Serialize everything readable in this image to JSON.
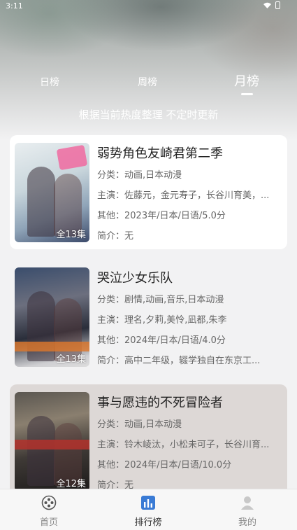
{
  "status_bar": {
    "time": "3:11"
  },
  "tabs": {
    "day": "日榜",
    "week": "周榜",
    "month": "月榜",
    "active": "month"
  },
  "subtitle": "根据当前热度整理 不定时更新",
  "items": [
    {
      "title": "弱势角色友崎君第二季",
      "genre": "分类：动画,日本动漫",
      "cast": "主演：佐藤元，金元寿子，长谷川育美，...",
      "other": "其他：2023年/日本/日语/5.0分",
      "intro": "简介：无",
      "episodes": "全13集"
    },
    {
      "title": "哭泣少女乐队",
      "genre": "分类：剧情,动画,音乐,日本动漫",
      "cast": "主演：理名,夕莉,美怜,凪都,朱李",
      "other": "其他：2024年/日本/日语/4.0分",
      "intro": "简介：高中二年级，辍学独自在东京工...",
      "episodes": "全13集"
    },
    {
      "title": "事与愿违的不死冒险者",
      "genre": "分类：动画,日本动漫",
      "cast": "主演：铃木崚汰，小松未可子，长谷川育...",
      "other": "其他：2024年/日本/日语/10.0分",
      "intro": "简介：无",
      "episodes": "全12集"
    }
  ],
  "bottom_nav": {
    "home": "首页",
    "rank": "排行榜",
    "me": "我的",
    "active": "rank"
  },
  "colors": {
    "accent_nav": "#3a7bd5",
    "title_text": "#222222",
    "meta_text": "#666666"
  }
}
